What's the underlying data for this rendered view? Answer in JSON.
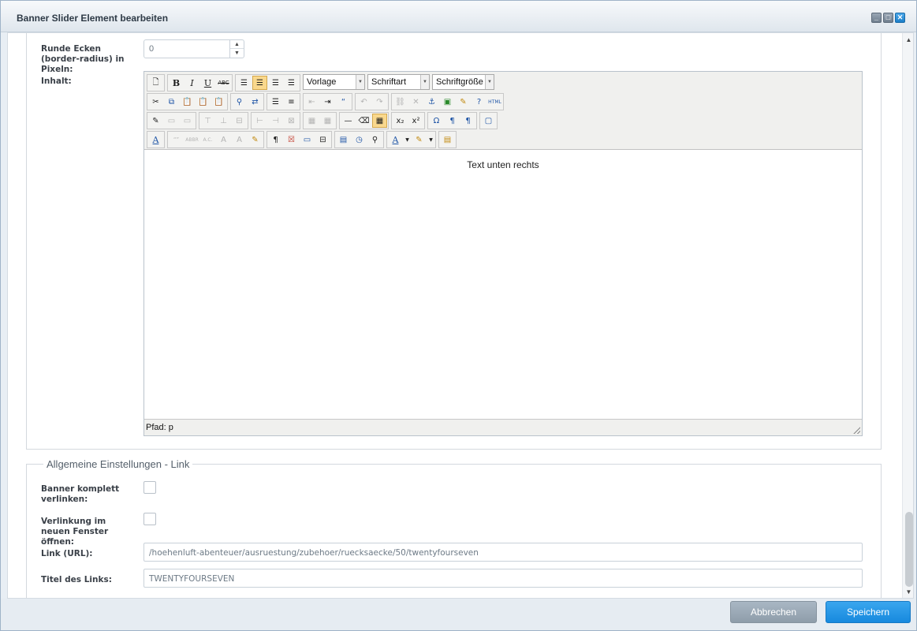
{
  "window": {
    "title": "Banner Slider Element bearbeiten"
  },
  "form": {
    "radius_label": "Runde Ecken (border-radius) in Pixeln:",
    "radius_value": "0",
    "content_label": "Inhalt:",
    "section_link_legend": "Allgemeine Einstellungen - Link",
    "link_whole_label": "Banner komplett verlinken:",
    "new_window_label": "Verlinkung im neuen Fenster öffnen:",
    "url_label": "Link (URL):",
    "url_value": "/hoehenluft-abenteuer/ausruestung/zubehoer/ruecksaecke/50/twentyfourseven",
    "link_title_label": "Titel des Links:",
    "link_title_value": "TWENTYFOURSEVEN"
  },
  "editor": {
    "format_select": "Vorlage",
    "font_select": "Schriftart",
    "size_select": "Schriftgröße",
    "content_text": "Text unten rechts",
    "path": "Pfad: p"
  },
  "footer": {
    "cancel_label": "Abbrechen",
    "save_label": "Speichern"
  },
  "colors": {
    "primary": "#1789de",
    "secondary": "#8e9daa",
    "active_toolbar": "#f9d88d"
  }
}
